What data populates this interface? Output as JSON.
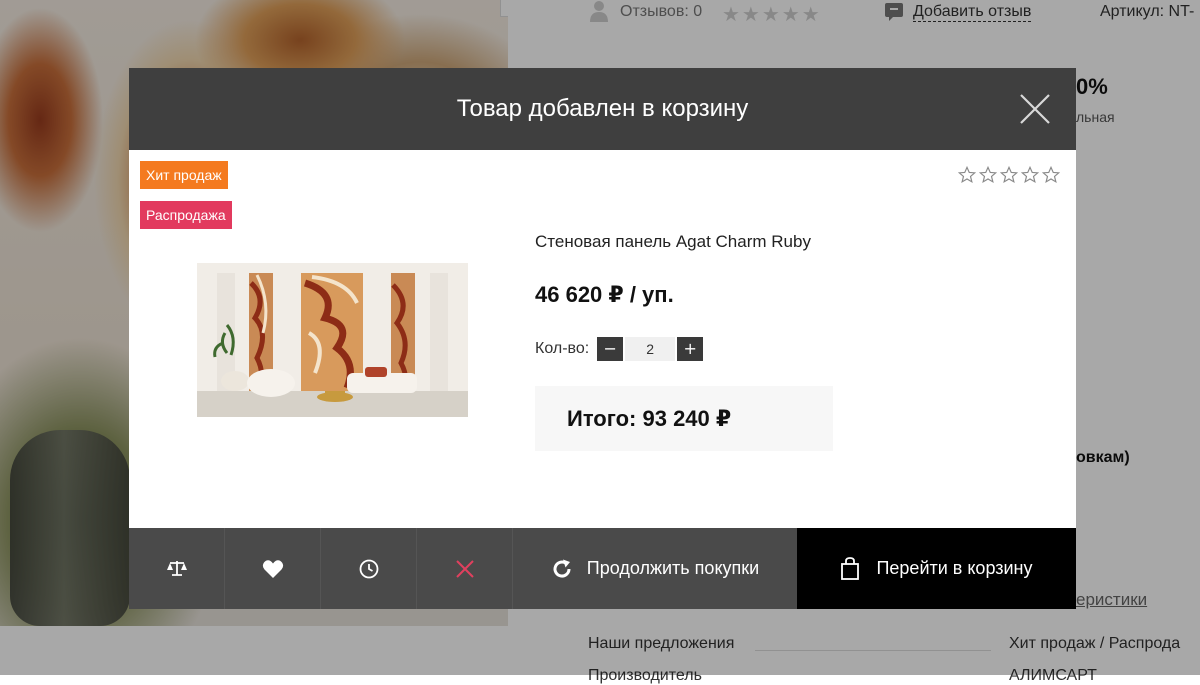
{
  "background_page": {
    "reviews_label": "Отзывов: 0",
    "add_review_label": "Добавить отзыв",
    "article_label": "Артикул: NT-",
    "discount_fragment": "0%",
    "discount_sub_fragment": "льная",
    "shipping_fragment": "овкам)",
    "characteristics_fragment": "еристики",
    "offers_label": "Наши предложения",
    "offers_value": "Хит продаж / Распрода",
    "brand_row_label": "Производитель",
    "brand_row_value": "АЛИМСАРТ"
  },
  "modal": {
    "title": "Товар добавлен в корзину",
    "badges": [
      "Хит продаж",
      "Распродажа"
    ],
    "product": {
      "title": "Стеновая панель Agat Charm Ruby",
      "price": "46 620 ₽ / уп."
    },
    "quantity": {
      "label": "Кол-во:",
      "minus": "−",
      "value": "2",
      "plus": "+"
    },
    "total": "Итого: 93 240 ₽",
    "rating": 0,
    "footer": {
      "icons": [
        "compare-icon",
        "heart-icon",
        "clock-icon",
        "remove-icon"
      ],
      "continue_label": "Продолжить покупки",
      "cart_label": "Перейти в корзину"
    }
  },
  "colors": {
    "header_bg": "#3f3f3f",
    "badge_hit": "#f47a1f",
    "badge_sale": "#e23a5e",
    "remove_icon": "#e0405e",
    "cart_button_bg": "#000000"
  }
}
